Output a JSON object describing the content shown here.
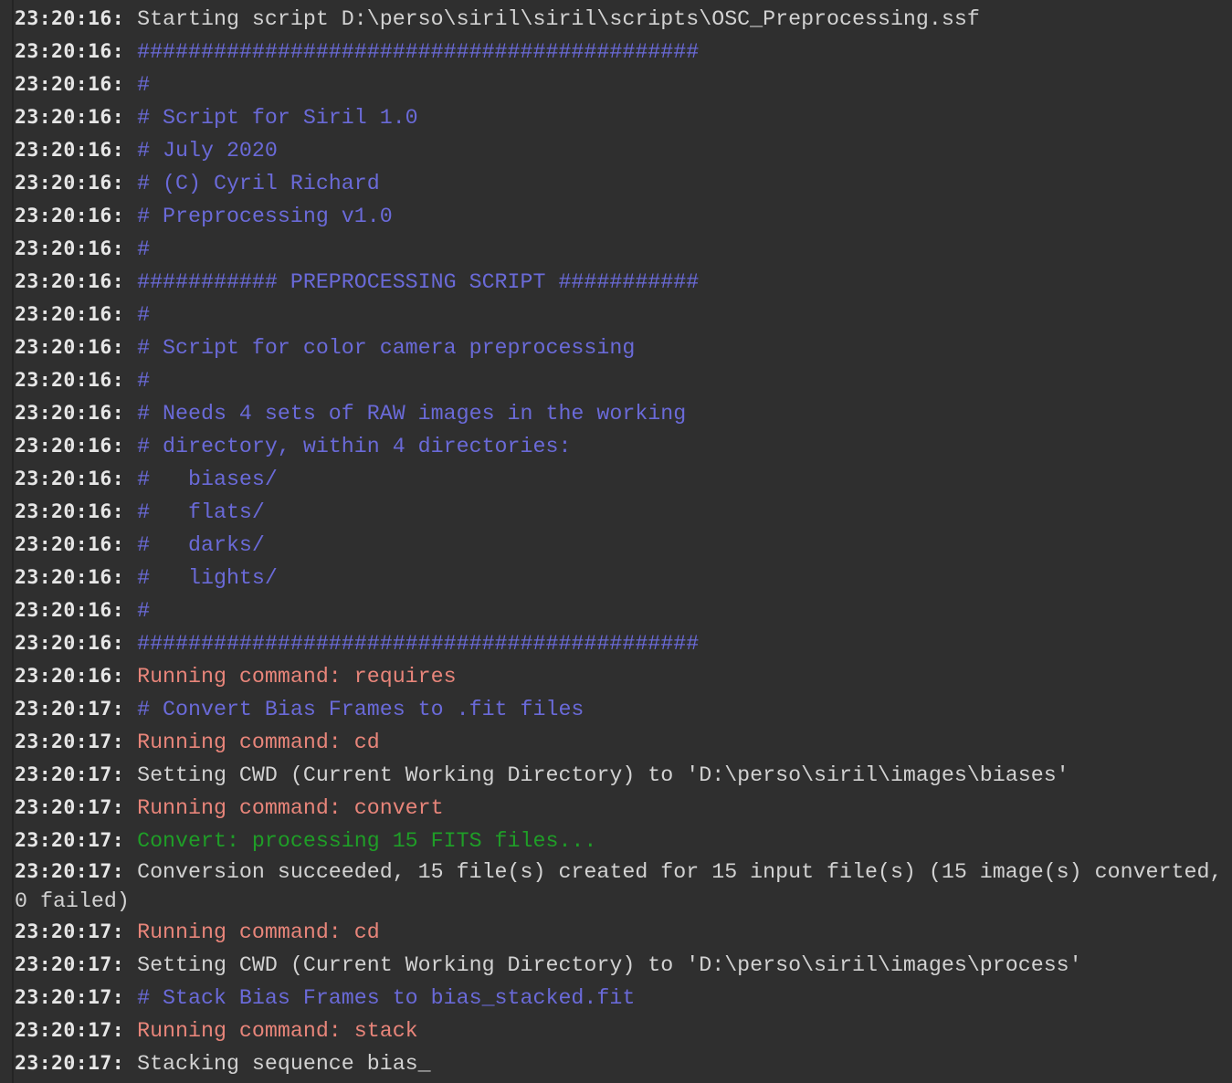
{
  "app": {
    "panel": "console-log"
  },
  "colors": {
    "background": "#2f2f2f",
    "timestamp": "#e6e6e6",
    "normal": "#d2d2d2",
    "comment": "#6a6ad8",
    "command": "#e8857a",
    "info": "#1f9e27"
  },
  "log": [
    {
      "time": "23:20:16:",
      "type": "normal",
      "text": "Starting script D:\\perso\\siril\\siril\\scripts\\OSC_Preprocessing.ssf"
    },
    {
      "time": "23:20:16:",
      "type": "comment",
      "text": "############################################"
    },
    {
      "time": "23:20:16:",
      "type": "comment",
      "text": "#"
    },
    {
      "time": "23:20:16:",
      "type": "comment",
      "text": "# Script for Siril 1.0"
    },
    {
      "time": "23:20:16:",
      "type": "comment",
      "text": "# July 2020"
    },
    {
      "time": "23:20:16:",
      "type": "comment",
      "text": "# (C) Cyril Richard"
    },
    {
      "time": "23:20:16:",
      "type": "comment",
      "text": "# Preprocessing v1.0"
    },
    {
      "time": "23:20:16:",
      "type": "comment",
      "text": "#"
    },
    {
      "time": "23:20:16:",
      "type": "comment",
      "text": "########### PREPROCESSING SCRIPT ###########"
    },
    {
      "time": "23:20:16:",
      "type": "comment",
      "text": "#"
    },
    {
      "time": "23:20:16:",
      "type": "comment",
      "text": "# Script for color camera preprocessing"
    },
    {
      "time": "23:20:16:",
      "type": "comment",
      "text": "#"
    },
    {
      "time": "23:20:16:",
      "type": "comment",
      "text": "# Needs 4 sets of RAW images in the working"
    },
    {
      "time": "23:20:16:",
      "type": "comment",
      "text": "# directory, within 4 directories:"
    },
    {
      "time": "23:20:16:",
      "type": "comment",
      "text": "#   biases/"
    },
    {
      "time": "23:20:16:",
      "type": "comment",
      "text": "#   flats/"
    },
    {
      "time": "23:20:16:",
      "type": "comment",
      "text": "#   darks/"
    },
    {
      "time": "23:20:16:",
      "type": "comment",
      "text": "#   lights/"
    },
    {
      "time": "23:20:16:",
      "type": "comment",
      "text": "#"
    },
    {
      "time": "23:20:16:",
      "type": "comment",
      "text": "############################################"
    },
    {
      "time": "23:20:16:",
      "type": "command",
      "text": "Running command: requires"
    },
    {
      "time": "23:20:17:",
      "type": "comment",
      "text": "# Convert Bias Frames to .fit files"
    },
    {
      "time": "23:20:17:",
      "type": "command",
      "text": "Running command: cd"
    },
    {
      "time": "23:20:17:",
      "type": "normal",
      "text": "Setting CWD (Current Working Directory) to 'D:\\perso\\siril\\images\\biases'"
    },
    {
      "time": "23:20:17:",
      "type": "command",
      "text": "Running command: convert"
    },
    {
      "time": "23:20:17:",
      "type": "info",
      "text": "Convert: processing 15 FITS files..."
    },
    {
      "time": "23:20:17:",
      "type": "normal",
      "text": "Conversion succeeded, 15 file(s) created for 15 input file(s) (15 image(s) converted, 0 failed)"
    },
    {
      "time": "23:20:17:",
      "type": "command",
      "text": "Running command: cd"
    },
    {
      "time": "23:20:17:",
      "type": "normal",
      "text": "Setting CWD (Current Working Directory) to 'D:\\perso\\siril\\images\\process'"
    },
    {
      "time": "23:20:17:",
      "type": "comment",
      "text": "# Stack Bias Frames to bias_stacked.fit"
    },
    {
      "time": "23:20:17:",
      "type": "command",
      "text": "Running command: stack"
    },
    {
      "time": "23:20:17:",
      "type": "normal",
      "text": "Stacking sequence bias_"
    }
  ]
}
